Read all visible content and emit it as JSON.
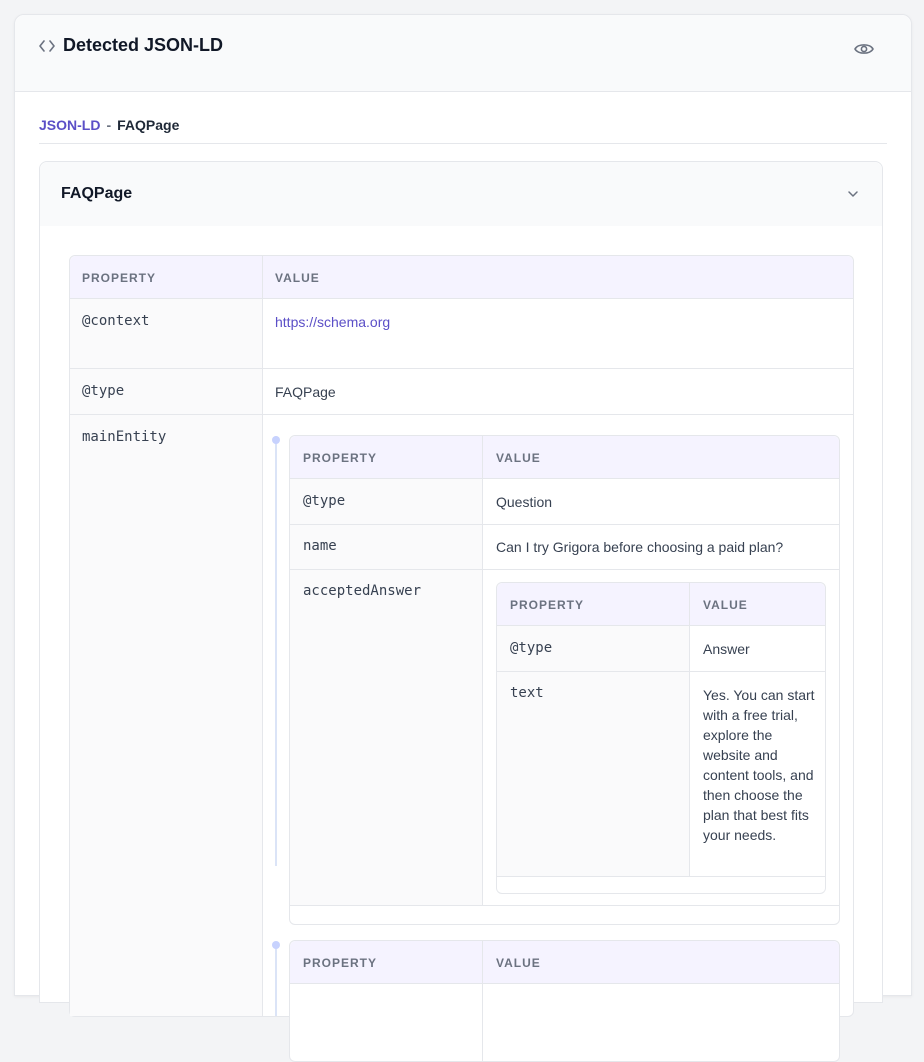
{
  "card": {
    "title": "Detected JSON-LD",
    "icons": {
      "code": "code-icon",
      "view": "eye-icon"
    }
  },
  "breadcrumb": {
    "root": "JSON-LD",
    "separator": "-",
    "current": "FAQPage"
  },
  "accordion": {
    "title": "FAQPage",
    "icon": "chevron-down-icon"
  },
  "columns": {
    "property": "PROPERTY",
    "value": "VALUE"
  },
  "root_table": {
    "rows": [
      {
        "property": "@context",
        "value": "https://schema.org"
      },
      {
        "property": "@type",
        "value": "FAQPage"
      },
      {
        "property": "mainEntity"
      }
    ]
  },
  "question_1": {
    "rows": [
      {
        "property": "@type",
        "value": "Question"
      },
      {
        "property": "name",
        "value": "Can I try Grigora before choosing a paid plan?"
      },
      {
        "property": "acceptedAnswer"
      }
    ],
    "answer": {
      "rows": [
        {
          "property": "@type",
          "value": "Answer"
        },
        {
          "property": "text",
          "value": "Yes. You can start with a free trial, explore the website and content tools, and then choose the plan that best fits your needs."
        }
      ]
    }
  },
  "colors": {
    "accent": "#5b4fc7",
    "header_bg": "#f5f3ff",
    "border": "#e5e7eb"
  }
}
